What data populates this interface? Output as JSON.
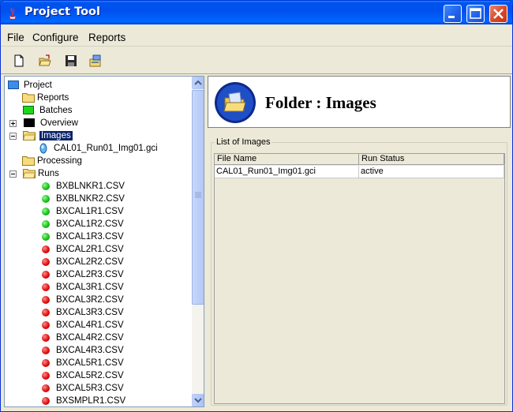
{
  "window": {
    "title": "Project Tool"
  },
  "menu": {
    "items": [
      "File",
      "Configure",
      "Reports"
    ]
  },
  "toolbar": {
    "buttons": [
      {
        "icon": "new-document-icon"
      },
      {
        "icon": "open-folder-icon"
      },
      {
        "icon": "save-disk-icon"
      },
      {
        "icon": "export-icon"
      }
    ]
  },
  "tree": {
    "root": "Project",
    "nodes": [
      {
        "label": "Reports"
      },
      {
        "label": "Batches"
      },
      {
        "label": "Overview"
      },
      {
        "label": "Images",
        "selected": true
      },
      {
        "label": "CAL01_Run01_Img01.gci"
      },
      {
        "label": "Processing"
      },
      {
        "label": "Runs"
      }
    ],
    "runs": [
      {
        "label": "BXBLNKR1.CSV",
        "status": "green"
      },
      {
        "label": "BXBLNKR2.CSV",
        "status": "green"
      },
      {
        "label": "BXCAL1R1.CSV",
        "status": "green"
      },
      {
        "label": "BXCAL1R2.CSV",
        "status": "green"
      },
      {
        "label": "BXCAL1R3.CSV",
        "status": "green"
      },
      {
        "label": "BXCAL2R1.CSV",
        "status": "red"
      },
      {
        "label": "BXCAL2R2.CSV",
        "status": "red"
      },
      {
        "label": "BXCAL2R3.CSV",
        "status": "red"
      },
      {
        "label": "BXCAL3R1.CSV",
        "status": "red"
      },
      {
        "label": "BXCAL3R2.CSV",
        "status": "red"
      },
      {
        "label": "BXCAL3R3.CSV",
        "status": "red"
      },
      {
        "label": "BXCAL4R1.CSV",
        "status": "red"
      },
      {
        "label": "BXCAL4R2.CSV",
        "status": "red"
      },
      {
        "label": "BXCAL4R3.CSV",
        "status": "red"
      },
      {
        "label": "BXCAL5R1.CSV",
        "status": "red"
      },
      {
        "label": "BXCAL5R2.CSV",
        "status": "red"
      },
      {
        "label": "BXCAL5R3.CSV",
        "status": "red"
      },
      {
        "label": "BXSMPLR1.CSV",
        "status": "red"
      }
    ]
  },
  "detail": {
    "title": "Folder : Images",
    "group_label": "List of Images",
    "columns": [
      "File Name",
      "Run Status"
    ],
    "rows": [
      [
        "CAL01_Run01_Img01.gci",
        "active"
      ]
    ]
  },
  "colors": {
    "title_bar": "#0054e3",
    "selection": "#0a246a",
    "status_green": "#1fbf1f",
    "status_red": "#e01010"
  }
}
